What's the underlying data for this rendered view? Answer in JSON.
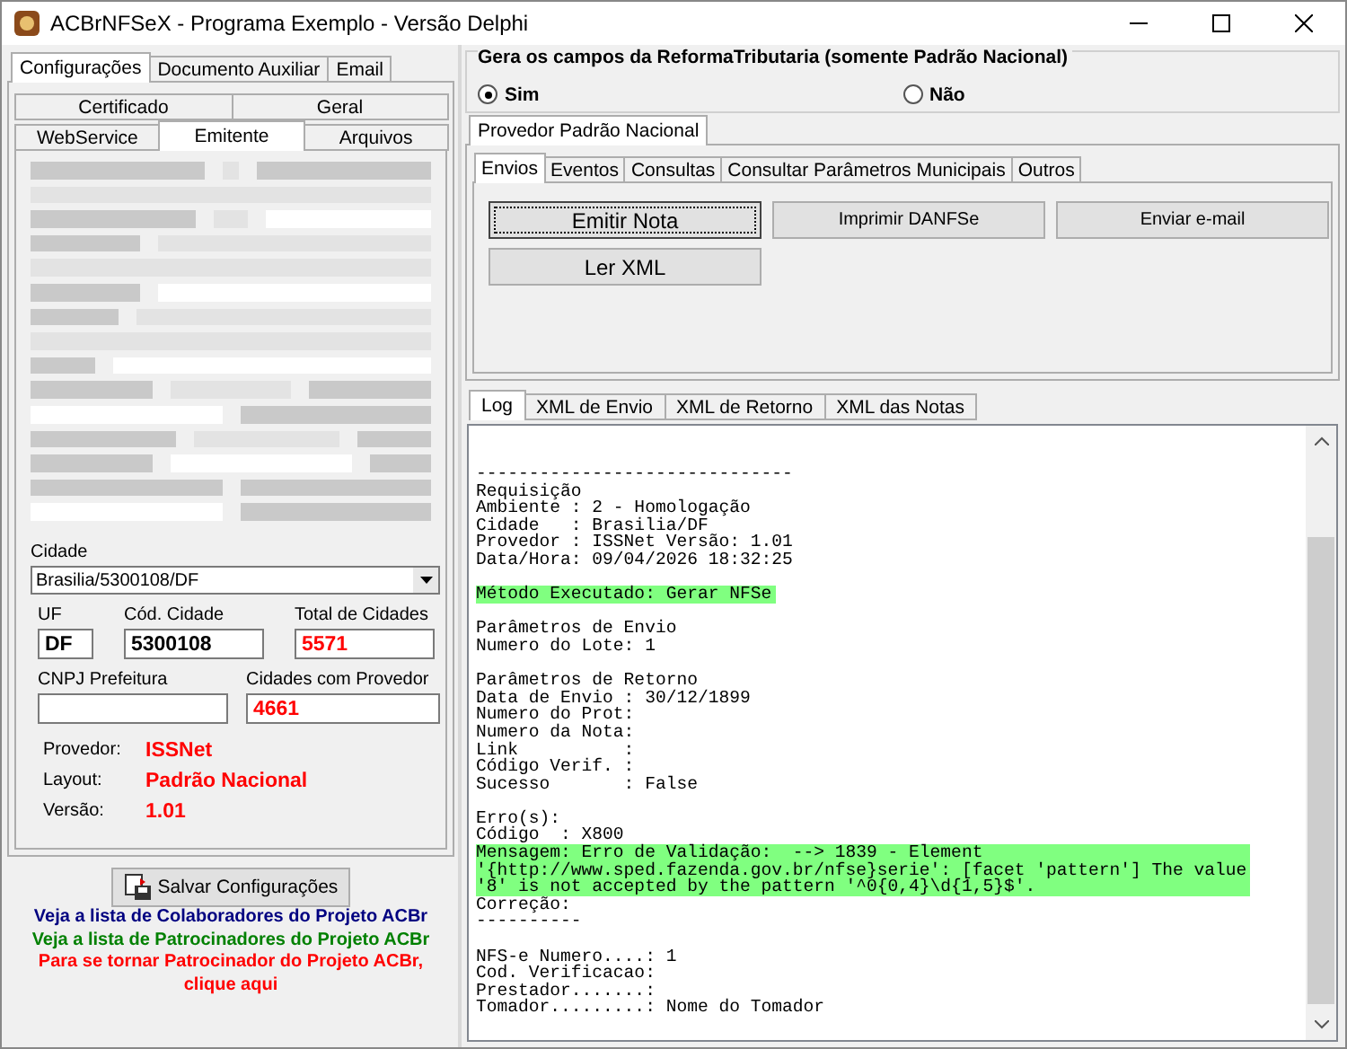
{
  "window": {
    "title": "ACBrNFSeX - Programa Exemplo - Versão Delphi"
  },
  "left_tabs": [
    {
      "label": "Configurações",
      "selected": true
    },
    {
      "label": "Documento Auxiliar",
      "selected": false
    },
    {
      "label": "Email",
      "selected": false
    }
  ],
  "config_tabs_row1": [
    {
      "label": "Certificado",
      "selected": false
    },
    {
      "label": "Geral",
      "selected": false
    }
  ],
  "config_tabs_row2": [
    {
      "label": "WebService",
      "selected": false
    },
    {
      "label": "Emitente",
      "selected": true
    },
    {
      "label": "Arquivos",
      "selected": false
    }
  ],
  "cidade": {
    "label": "Cidade",
    "value": "Brasilia/5300108/DF"
  },
  "fields_row1": [
    {
      "label": "UF",
      "value": "DF",
      "alert": false
    },
    {
      "label": "Cód. Cidade",
      "value": "5300108",
      "alert": false
    },
    {
      "label": "Total de Cidades",
      "value": "5571",
      "alert": true
    }
  ],
  "fields_row2": [
    {
      "label": "CNPJ Prefeitura"
    },
    {
      "label": "Cidades com Provedor",
      "value": "4661",
      "alert": true
    }
  ],
  "info": [
    {
      "label": "Provedor:",
      "value": "ISSNet"
    },
    {
      "label": "Layout:",
      "value": "Padrão Nacional"
    },
    {
      "label": "Versão:",
      "value": "1.01"
    }
  ],
  "save_button": "Salvar Configurações",
  "links": [
    {
      "text": "Veja a lista de Colaboradores do Projeto ACBr",
      "color": "#000080"
    },
    {
      "text": "Veja a lista de Patrocinadores do Projeto ACBr",
      "color": "#008000"
    },
    {
      "text": "Para se tornar Patrocinador do Projeto ACBr,\nclique aqui",
      "color": "#ff0000"
    }
  ],
  "reforma": {
    "title": "Gera os campos da ReformaTributaria (somente Padrão Nacional)",
    "options": [
      {
        "label": "Sim",
        "selected": true
      },
      {
        "label": "Não",
        "selected": false
      }
    ]
  },
  "provider_tabs": [
    {
      "label": "Provedor Padrão Nacional",
      "selected": true
    }
  ],
  "action_tabs": [
    {
      "label": "Envios",
      "selected": true
    },
    {
      "label": "Eventos",
      "selected": false
    },
    {
      "label": "Consultas",
      "selected": false
    },
    {
      "label": "Consultar Parâmetros Municipais",
      "selected": false
    },
    {
      "label": "Outros",
      "selected": false
    }
  ],
  "action_buttons": [
    {
      "label": "Emitir Nota",
      "kind": "large",
      "focused": true
    },
    {
      "label": "Imprimir DANFSe",
      "kind": "small",
      "focused": false
    },
    {
      "label": "Enviar e-mail",
      "kind": "small",
      "focused": false
    },
    {
      "label": "Ler XML",
      "kind": "large",
      "focused": false
    }
  ],
  "output_tabs": [
    {
      "label": "Log",
      "selected": true
    },
    {
      "label": "XML de Envio",
      "selected": false
    },
    {
      "label": "XML de Retorno",
      "selected": false
    },
    {
      "label": "XML das Notas",
      "selected": false
    }
  ],
  "log": {
    "paragraphs": [
      [
        {
          "text": "------------------------------",
          "highlighted": false
        },
        {
          "text": "Requisição",
          "highlighted": false
        },
        {
          "text": "Ambiente : 2 - Homologação",
          "highlighted": false
        },
        {
          "text": "Cidade   : Brasilia/DF",
          "highlighted": false
        },
        {
          "text": "Provedor : ISSNet Versão: 1.01",
          "highlighted": false
        },
        {
          "text": "Data/Hora: 09/04/2026 18:32:25",
          "highlighted": false
        }
      ],
      [
        {
          "text": "Método Executado: Gerar NFSe",
          "highlighted": true
        }
      ],
      [
        {
          "text": "Parâmetros de Envio",
          "highlighted": false
        },
        {
          "text": "Numero do Lote: 1",
          "highlighted": false
        }
      ],
      [
        {
          "text": "Parâmetros de Retorno",
          "highlighted": false
        },
        {
          "text": "Data de Envio : 30/12/1899",
          "highlighted": false
        },
        {
          "text": "Numero do Prot:",
          "highlighted": false
        },
        {
          "text": "Numero da Nota:",
          "highlighted": false
        },
        {
          "text": "Link          :",
          "highlighted": false
        },
        {
          "text": "Código Verif. :",
          "highlighted": false
        },
        {
          "text": "Sucesso       : False",
          "highlighted": false
        }
      ],
      [
        {
          "text": "Erro(s):",
          "highlighted": false
        },
        {
          "text": "Código  : X800",
          "highlighted": false
        },
        {
          "text": "Mensagem: Erro de Validação:  --> 1839 - Element",
          "highlighted": true
        },
        {
          "text": "'{http://www.sped.fazenda.gov.br/nfse}serie': [facet 'pattern'] The value",
          "highlighted": true
        },
        {
          "text": "'8' is not accepted by the pattern '^0{0,4}\\d{1,5}$'.",
          "highlighted": true
        },
        {
          "text": "Correção:",
          "highlighted": false
        },
        {
          "text": "----------",
          "highlighted": false
        }
      ],
      [
        {
          "text": "NFS-e Numero....: 1",
          "highlighted": false
        },
        {
          "text": "Cod. Verificacao:",
          "highlighted": false
        },
        {
          "text": "Prestador.......:",
          "highlighted": false
        },
        {
          "text": "Tomador.........: Nome do Tomador",
          "highlighted": false
        }
      ]
    ]
  }
}
